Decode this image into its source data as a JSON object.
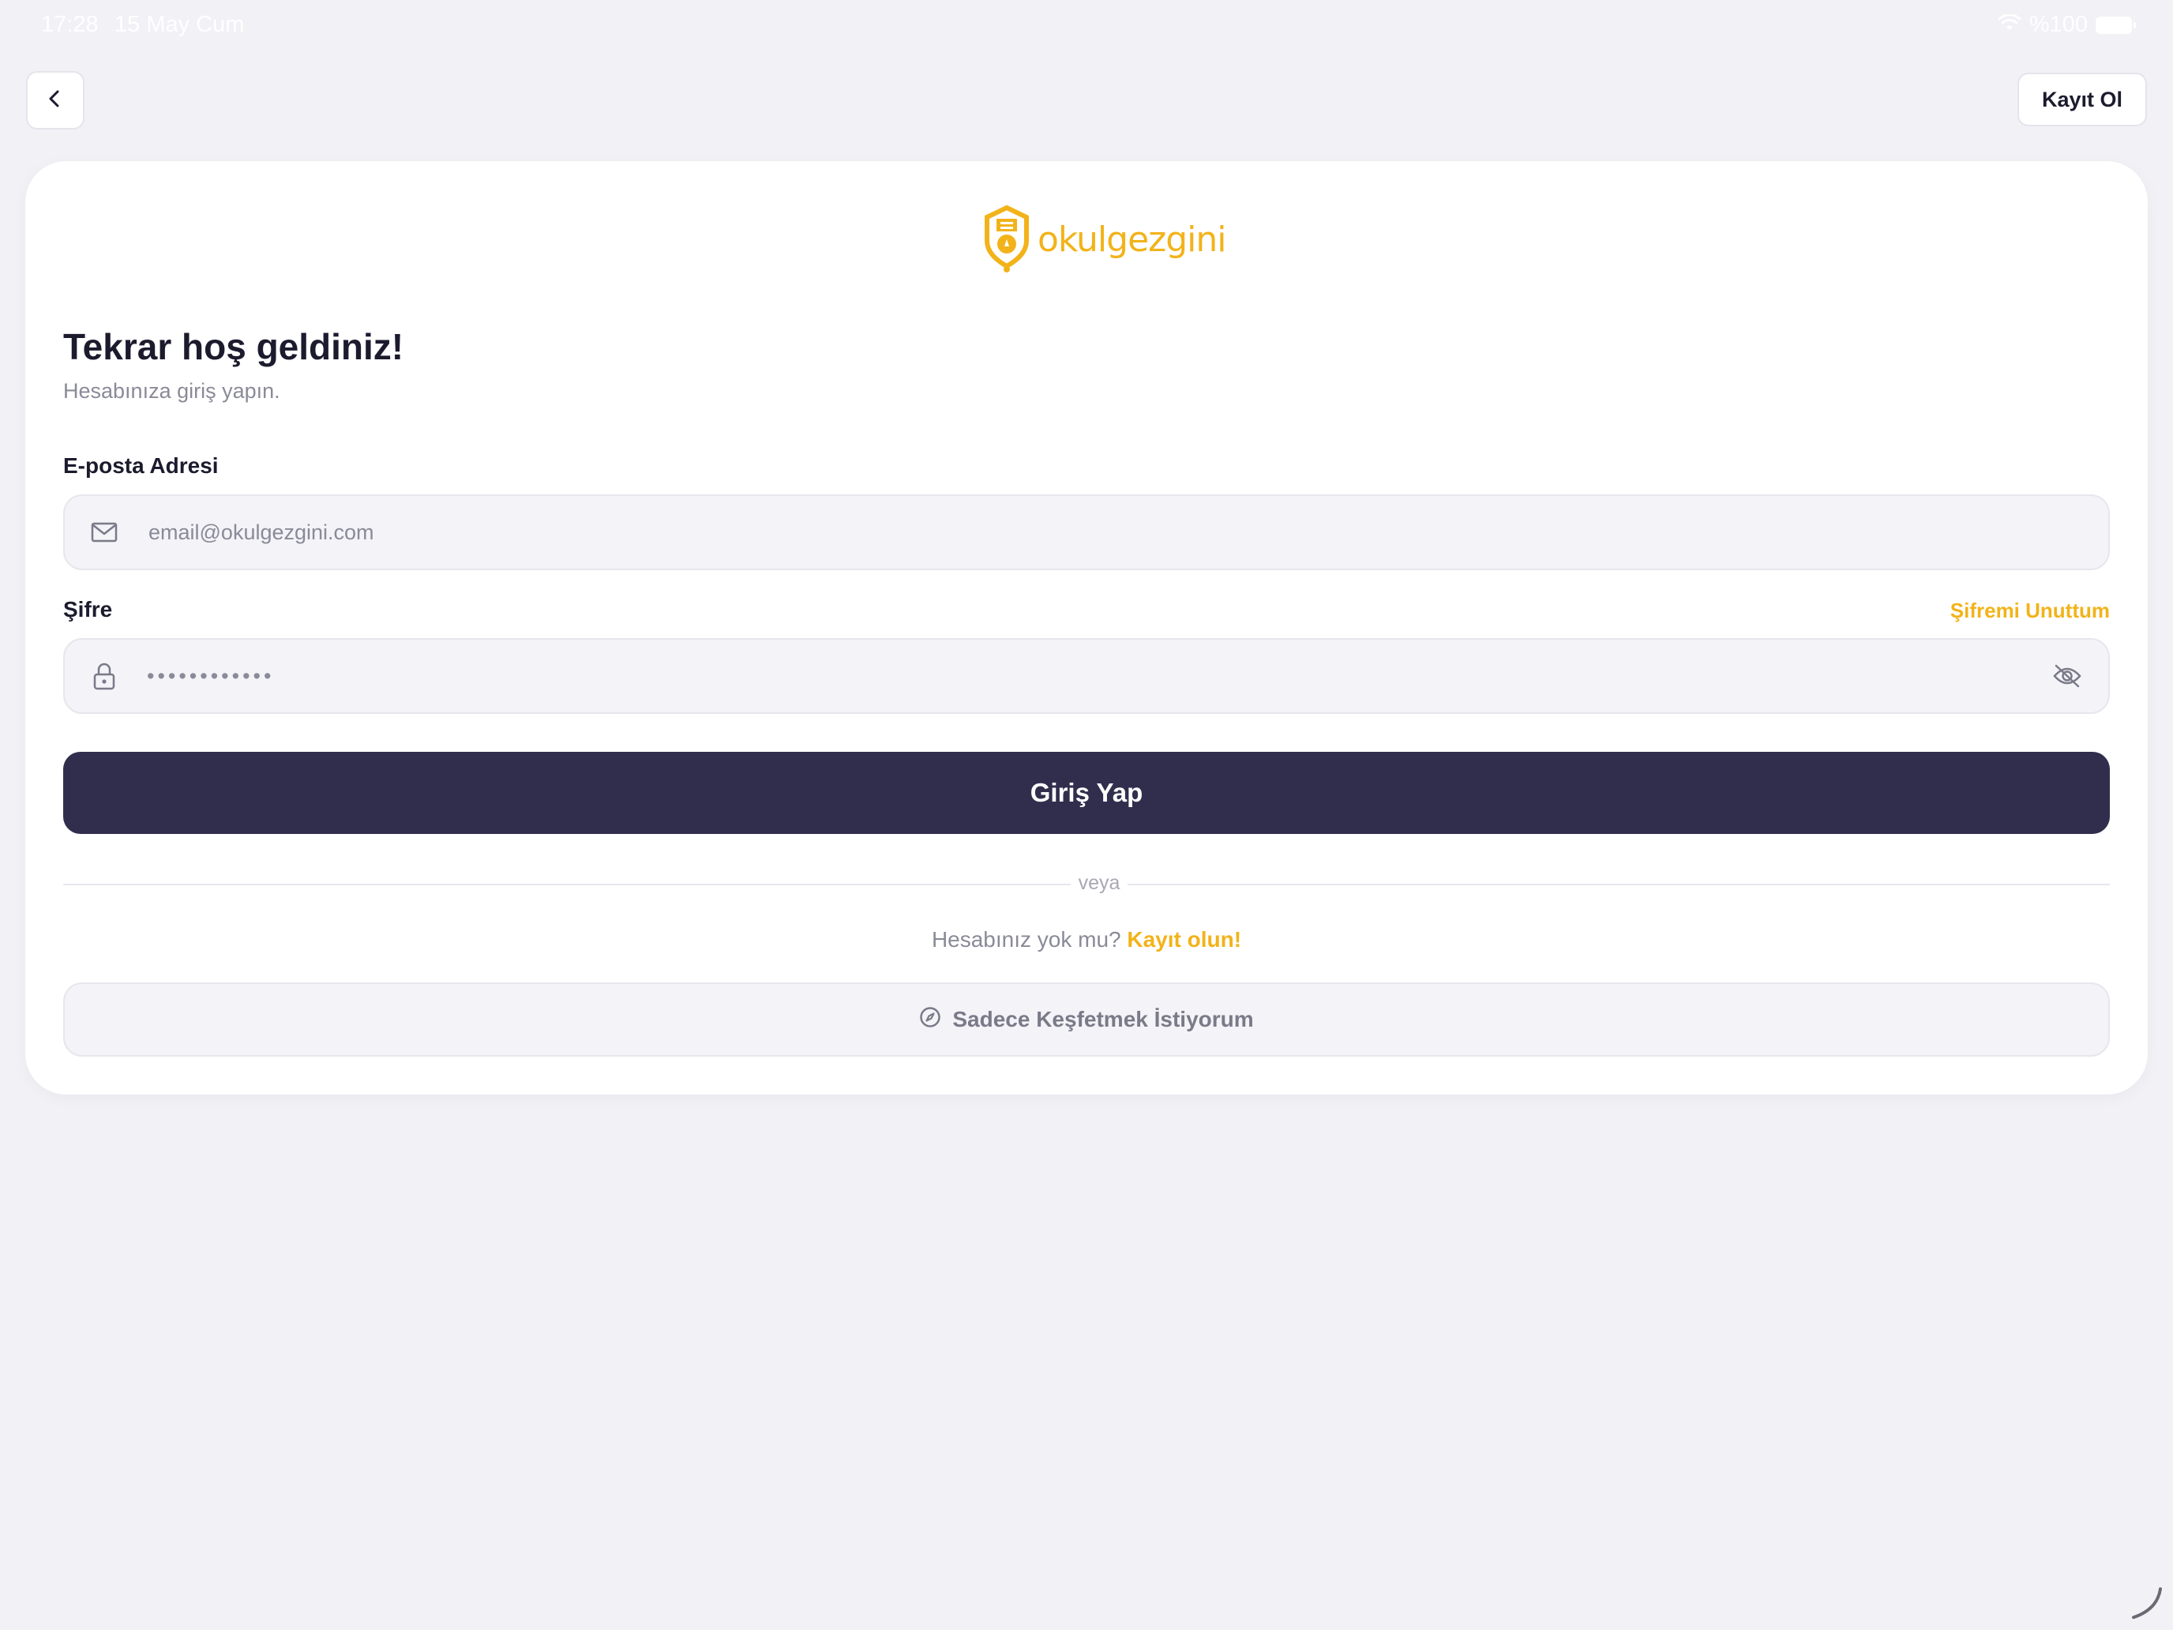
{
  "status_bar": {
    "time": "17:28",
    "date": "15 May Cum",
    "battery": "%100"
  },
  "header": {
    "back_icon": "chevron-left-icon",
    "register_label": "Kayıt Ol"
  },
  "logo": {
    "text": "okulgezgini",
    "color": "#f2b31a"
  },
  "login": {
    "title": "Tekrar hoş geldiniz!",
    "subtitle": "Hesabınıza giriş yapın.",
    "email_label": "E-posta Adresi",
    "email_placeholder": "email@okulgezgini.com",
    "email_icon": "mail-icon",
    "password_label": "Şifre",
    "forgot_label": "Şifremi Unuttum",
    "password_value": "••••••••••••",
    "password_icon": "lock-icon",
    "visibility_icon": "eye-off-icon",
    "submit_label": "Giriş Yap",
    "divider_text": "veya",
    "signup_prompt": "Hesabınız yok mu?",
    "signup_link": "Kayıt olun!",
    "explore_label": "Sadece Keşfetmek İstiyorum",
    "explore_icon": "compass-icon"
  },
  "colors": {
    "accent": "#f2b31a",
    "primary_button": "#312e4d",
    "background": "#f1f1f6"
  }
}
